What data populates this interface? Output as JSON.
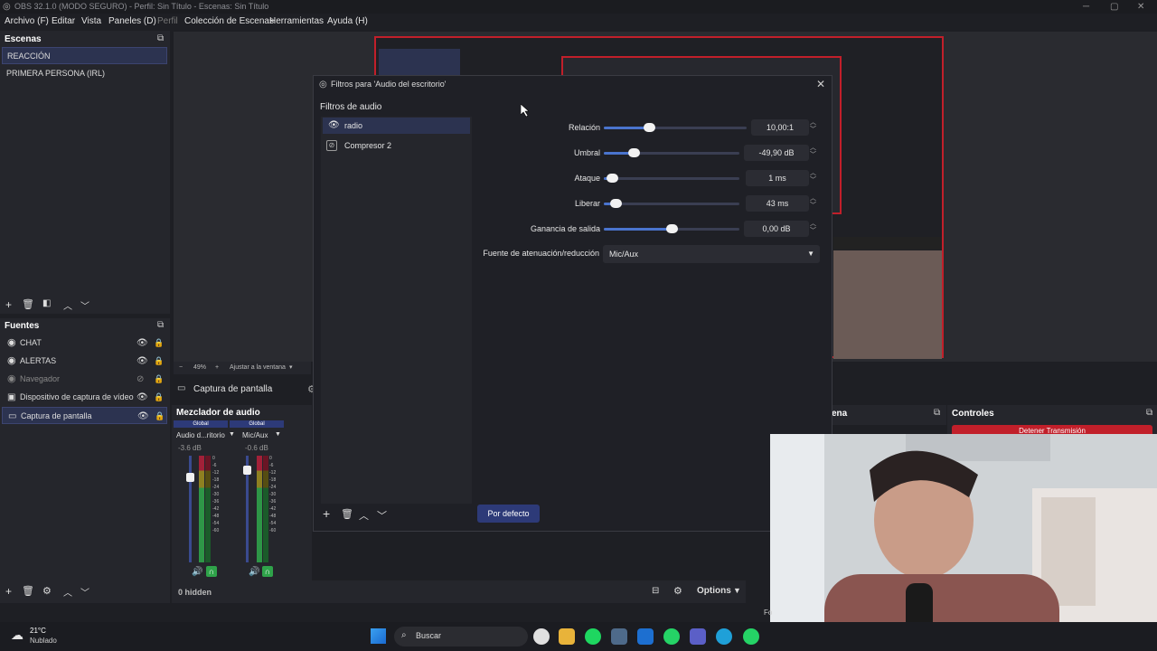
{
  "window": {
    "title": "OBS 32.1.0 (MODO SEGURO) - Perfil: Sin Título - Escenas: Sin Título",
    "minimize": "─",
    "maximize": "▢",
    "close": "✕"
  },
  "menu": [
    "Archivo (F)",
    "Editar",
    "Vista",
    "Paneles (D)",
    "Perfil",
    "Colección de Escenas",
    "Herramientas",
    "Ayuda (H)"
  ],
  "scenes": {
    "title": "Escenas",
    "items": [
      "REACCIÓN",
      "PRIMERA PERSONA (IRL)"
    ],
    "selected": 0
  },
  "sources": {
    "title": "Fuentes",
    "items": [
      {
        "label": "CHAT",
        "icon": "browser-icon"
      },
      {
        "label": "ALERTAS",
        "icon": "browser-icon"
      },
      {
        "label": "Navegador",
        "icon": "browser-icon",
        "hidden": true
      },
      {
        "label": "Dispositivo de captura de vídeo",
        "icon": "camera-icon"
      },
      {
        "label": "Captura de pantalla",
        "icon": "monitor-icon"
      }
    ]
  },
  "preview": {
    "zoom": "49%",
    "fit_label": "Ajustar a la ventana",
    "zoom_minus": "−",
    "zoom_plus": "+",
    "source_label": "Captura de pantalla"
  },
  "mixer": {
    "title": "Mezclador de audio",
    "channels": [
      {
        "badge": "Global",
        "name": "Audio d...ritorio",
        "db": "-3.6 dB",
        "fader_level": 0.82
      },
      {
        "badge": "Global",
        "name": "Mic/Aux",
        "db": "-0.6 dB",
        "fader_level": 0.9
      }
    ],
    "scale": [
      "0",
      "-6",
      "-12",
      "-18",
      "-24",
      "-30",
      "-36",
      "-42",
      "-48",
      "-54",
      "-60"
    ],
    "hidden_label": "0 hidden",
    "options_label": "Options"
  },
  "transitions_title_fragment": "ena",
  "controls": {
    "title": "Controles",
    "stop_stream": "Detener Transmisión"
  },
  "dialog": {
    "title": "Filtros para 'Audio del escritorio'",
    "filters_label": "Filtros de audio",
    "filters": [
      {
        "label": "radio",
        "icon": "eye-icon",
        "selected": true
      },
      {
        "label": "Compresor 2",
        "icon": "eye-off-icon",
        "selected": false
      }
    ],
    "params": [
      {
        "label": "Relación",
        "value": "10,00:1",
        "level": 0.3
      },
      {
        "label": "Umbral",
        "value": "-49,90 dB",
        "level": 0.2
      },
      {
        "label": "Ataque",
        "value": "1 ms",
        "level": 0.02
      },
      {
        "label": "Liberar",
        "value": "43 ms",
        "level": 0.05
      },
      {
        "label": "Ganancia de salida",
        "value": "0,00 dB",
        "level": 0.5
      }
    ],
    "atten_label": "Fuente de atenuación/reducción",
    "atten_value": "Mic/Aux",
    "defaults_label": "Por defecto"
  },
  "taskbar": {
    "weather_temp": "21°C",
    "weather_desc": "Nublado",
    "search_placeholder": "Buscar",
    "fps_fragment": "Fo"
  },
  "colors": {
    "accent": "#2d3a78",
    "selection": "#2c3350",
    "live_red": "#c11f2a",
    "meter_green": "#2fa34a",
    "meter_red": "#b0203a"
  }
}
